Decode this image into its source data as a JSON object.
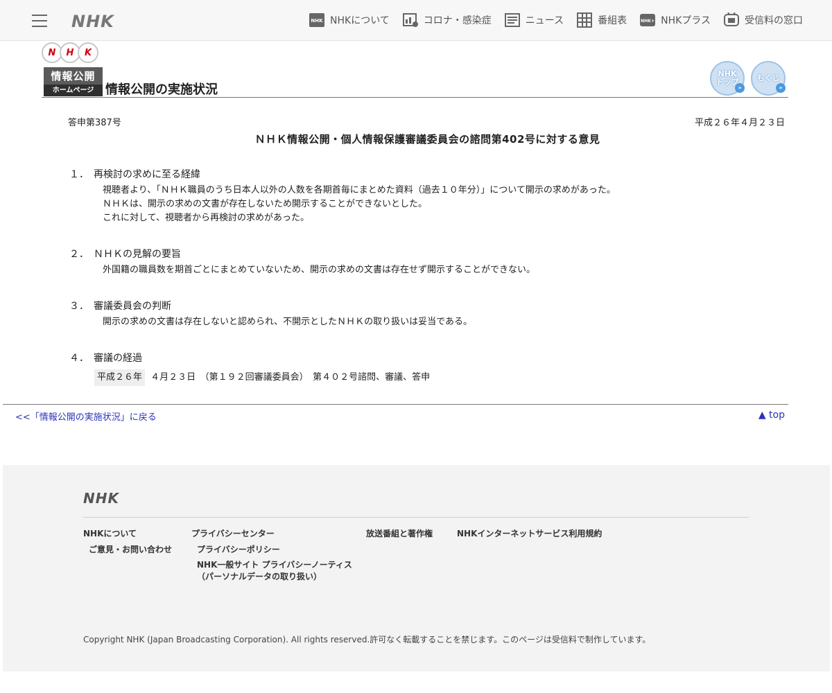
{
  "topnav": {
    "logo": "NHK",
    "links": [
      {
        "label": "NHKについて",
        "icon": "nhk-square-icon"
      },
      {
        "label": "コロナ・感染症",
        "icon": "corona-chart-icon"
      },
      {
        "label": "ニュース",
        "icon": "news-icon"
      },
      {
        "label": "番組表",
        "icon": "program-grid-icon"
      },
      {
        "label": "NHKプラス",
        "icon": "nhkplus-icon"
      },
      {
        "label": "受信料の窓口",
        "icon": "receiver-fee-icon"
      }
    ]
  },
  "header": {
    "ovals": [
      "N",
      "H",
      "K"
    ],
    "badge_line1": "情報公開",
    "badge_line2": "ホームページ",
    "title": "情報公開の実施状況",
    "btn_top": "NHK\nトップ",
    "btn_index": "もくじ"
  },
  "doc": {
    "number": "答申第387号",
    "date": "平成２６年４月２３日",
    "title": "ＮＨＫ情報公開・個人情報保護審議委員会の諮問第402号に対する意見",
    "sections": [
      {
        "num": "１．",
        "heading": "再検討の求めに至る経緯",
        "lines": [
          "視聴者より、「ＮＨＫ職員のうち日本人以外の人数を各期首毎にまとめた資料（過去１０年分）」について開示の求めがあった。",
          "ＮＨＫは、開示の求めの文書が存在しないため開示することができないとした。",
          "これに対して、視聴者から再検討の求めがあった。"
        ]
      },
      {
        "num": "２．",
        "heading": "ＮＨＫの見解の要旨",
        "lines": [
          "外国籍の職員数を期首ごとにまとめていないため、開示の求めの文書は存在せず開示することができない。"
        ]
      },
      {
        "num": "３．",
        "heading": "審議委員会の判断",
        "lines": [
          "開示の求めの文書は存在しないと認められ、不開示としたＮＨＫの取り扱いは妥当である。"
        ]
      },
      {
        "num": "４．",
        "heading": "審議の経過",
        "history_date": "平成２６年",
        "history_text": "４月２３日　（第１９２回審議委員会）　第４０２号諮問、審議、答申"
      }
    ]
  },
  "links": {
    "back": "<<「情報公開の実施状況」に戻る",
    "top": "▲ top"
  },
  "footer": {
    "logo": "NHK",
    "col1": "NHKについて",
    "col1_sub": "ご意見・お問い合わせ",
    "col2": "プライバシーセンター",
    "col2_sub1": "プライバシーポリシー",
    "col2_sub2": "NHK一般サイト プライバシーノーティス",
    "col2_sub3": "（パーソナルデータの取り扱い）",
    "col3": "放送番組と著作権",
    "col4": "NHKインターネットサービス利用規約",
    "copyright": "Copyright NHK (Japan Broadcasting Corporation). All rights reserved.許可なく転載することを禁じます。このページは受信料で制作しています。"
  }
}
